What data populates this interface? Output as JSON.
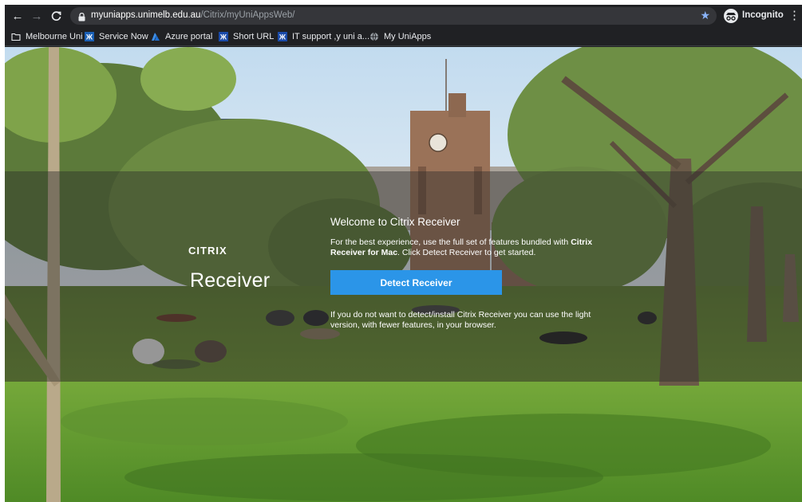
{
  "browser": {
    "url_host": "myuniapps.unimelb.edu.au",
    "url_path": "/Citrix/myUniAppsWeb/",
    "incognito_label": "Incognito",
    "bookmarks": [
      {
        "label": "Melbourne Uni",
        "icon": "folder-icon"
      },
      {
        "label": "Service Now",
        "icon": "servicenow-icon"
      },
      {
        "label": "Azure portal",
        "icon": "azure-icon"
      },
      {
        "label": "Short URL",
        "icon": "unimelb-icon"
      },
      {
        "label": "IT support ,y uni a...",
        "icon": "unimelb-icon"
      },
      {
        "label": "My UniApps",
        "icon": "globe-icon"
      }
    ]
  },
  "citrix": {
    "logo_small": "CITRIX",
    "logo_big": "Receiver",
    "welcome_title": "Welcome to Citrix Receiver",
    "intro_part1": "For the best experience, use the full set of features bundled with ",
    "intro_bold": "Citrix Receiver for Mac",
    "intro_part2": ". Click Detect Receiver to get started.",
    "detect_button": "Detect Receiver",
    "lite_text": "If you do not want to detect/install Citrix Receiver you can use the light version, with fewer features, in your browser."
  },
  "colors": {
    "button_blue": "#2b95e8",
    "link_teal": "#4fc3e0",
    "browser_dark": "#202124"
  }
}
